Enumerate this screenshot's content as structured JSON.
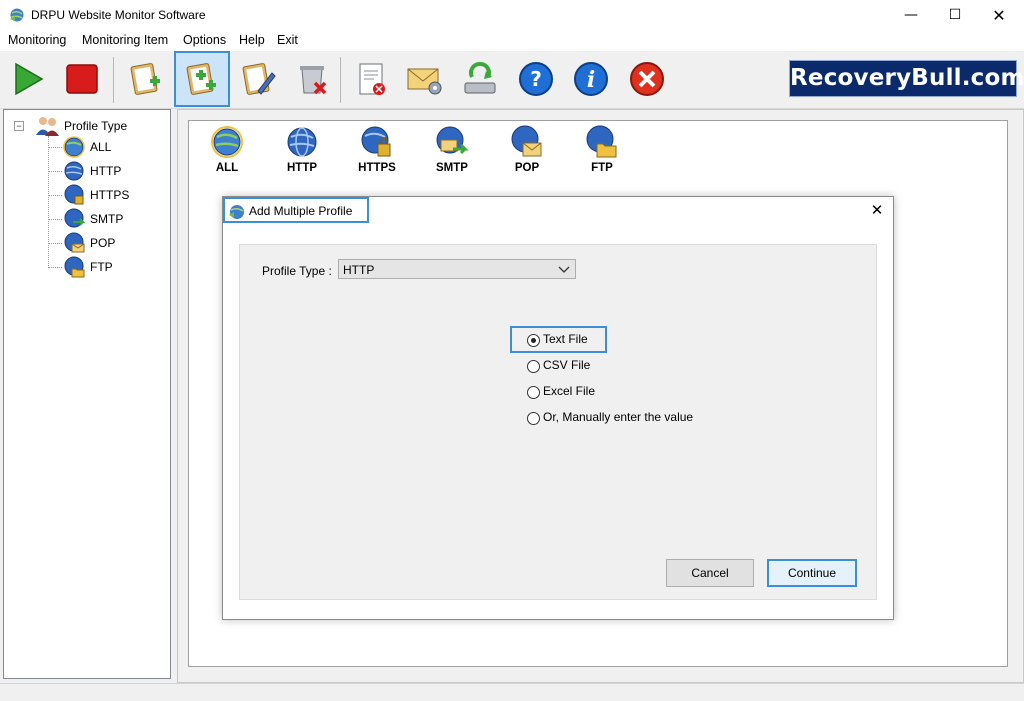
{
  "window": {
    "title": "DRPU Website Monitor Software",
    "controls": {
      "minimize": "—",
      "maximize": "☐",
      "close": "✕"
    }
  },
  "menu": [
    "Monitoring",
    "Monitoring Item",
    "Options",
    "Help",
    "Exit"
  ],
  "toolbar": {
    "buttons": [
      "start-icon",
      "stop-icon",
      "add-profile-icon",
      "add-multiple-profile-icon",
      "edit-profile-icon",
      "delete-icon",
      "report-icon",
      "email-settings-icon",
      "update-icon",
      "help-icon",
      "about-icon",
      "exit-icon"
    ],
    "selected": "add-multiple-profile-icon",
    "brand": "RecoveryBull.com"
  },
  "tree": {
    "root": "Profile Type",
    "expander": "−",
    "items": [
      "ALL",
      "HTTP",
      "HTTPS",
      "SMTP",
      "POP",
      "FTP"
    ]
  },
  "profile_types": [
    "ALL",
    "HTTP",
    "HTTPS",
    "SMTP",
    "POP",
    "FTP"
  ],
  "dialog": {
    "title": "Add Multiple Profile",
    "close": "✕",
    "profile_type_label": "Profile Type :",
    "profile_type_value": "HTTP",
    "options": [
      "Text File",
      "CSV File",
      "Excel File",
      "Or, Manually enter the value"
    ],
    "selected_option": "Text File",
    "cancel": "Cancel",
    "continue": "Continue"
  },
  "colors": {
    "accent": "#3c8fd6",
    "brand_bg": "#0b2a6b",
    "stop_red": "#d81b1b",
    "start_green": "#37a833"
  }
}
